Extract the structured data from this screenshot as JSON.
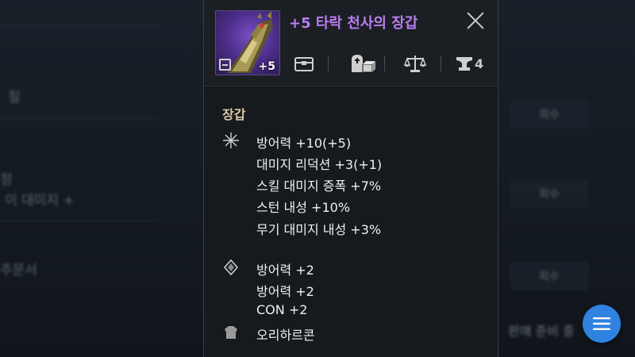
{
  "background": {
    "left_texts": [
      "칠",
      "정",
      "이 대미지 +",
      "주문서"
    ],
    "right_badges": [
      "",
      "",
      ""
    ],
    "right_buttons": [
      "회수",
      "회수",
      "회수"
    ],
    "right_text": "판매 준비 중"
  },
  "item": {
    "title": "+5 타락 천사의 장갑",
    "enchant_badge": "+5",
    "category": "장갑",
    "title_color": "#b97ef0"
  },
  "toolbar": {
    "icons": [
      "chest-icon",
      "skill-stone-icon",
      "scale-icon",
      "anvil-icon"
    ],
    "anvil_count": "4"
  },
  "stats": {
    "main": [
      "방어력 +10(+5)",
      "대미지 리덕션 +3(+1)",
      "스킬 대미지 증폭 +7%",
      "스턴 내성 +10%",
      "무기 대미지 내성 +3%"
    ],
    "bonus": [
      "방어력 +2",
      "방어력 +2",
      "CON +2"
    ],
    "material": "오리하르콘"
  },
  "colors": {
    "accent": "#2f82e0",
    "category": "#d9c7a8",
    "panel": "#16191d"
  }
}
